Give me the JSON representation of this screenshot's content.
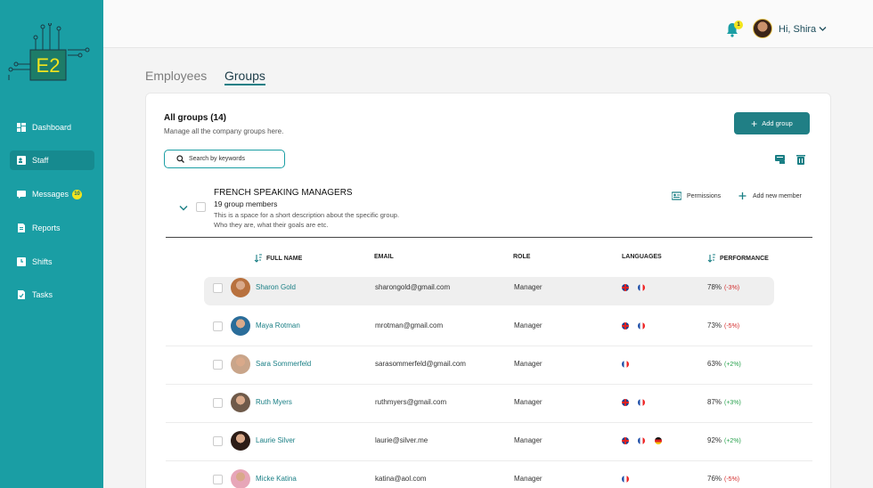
{
  "brand": {
    "logo_text": "E2"
  },
  "sidebar": {
    "items": [
      {
        "label": "Dashboard",
        "icon": "dashboard-icon"
      },
      {
        "label": "Staff",
        "icon": "staff-icon",
        "active": true
      },
      {
        "label": "Messages",
        "icon": "messages-icon",
        "badge": "10"
      },
      {
        "label": "Reports",
        "icon": "reports-icon"
      },
      {
        "label": "Shifts",
        "icon": "shifts-icon"
      },
      {
        "label": "Tasks",
        "icon": "tasks-icon"
      }
    ]
  },
  "header": {
    "notification_count": "1",
    "greeting": "Hi, Shira"
  },
  "tabs": [
    {
      "label": "Employees"
    },
    {
      "label": "Groups",
      "active": true
    }
  ],
  "panel": {
    "title": "All groups (14)",
    "subtitle": "Manage all the company groups here.",
    "add_button": "Add group",
    "search_placeholder": "Search by keywords"
  },
  "group": {
    "name": "FRENCH SPEAKING MANAGERS",
    "members": "19  group members",
    "description_line1": "This is a space for a short description about the specific group.",
    "description_line2": "Who they are, what their goals are etc.",
    "permissions": "Permissions",
    "add_member": "Add new member"
  },
  "table": {
    "columns": {
      "name": "FULL NAME",
      "email": "EMAIL",
      "role": "ROLE",
      "languages": "LANGUAGES",
      "performance": "PERFORMANCE"
    },
    "rows": [
      {
        "name": "Sharon Gold",
        "email": "sharongold@gmail.com",
        "role": "Manager",
        "languages": [
          "uk",
          "fr"
        ],
        "performance": "78%",
        "delta": "(-3%)",
        "trend": "neg",
        "avatar_color": "#b8713e"
      },
      {
        "name": "Maya Rotman",
        "email": "mrotman@gmail.com",
        "role": "Manager",
        "languages": [
          "uk",
          "fr"
        ],
        "performance": "73%",
        "delta": "(-5%)",
        "trend": "neg",
        "avatar_color": "#2a6d9a"
      },
      {
        "name": "Sara Sommerfeld",
        "email": "sarasommerfeld@gmail.com",
        "role": "Manager",
        "languages": [
          "fr"
        ],
        "performance": "63%",
        "delta": "(+2%)",
        "trend": "pos",
        "avatar_color": "#c9a58a"
      },
      {
        "name": "Ruth Myers",
        "email": "ruthmyers@gmail.com",
        "role": "Manager",
        "languages": [
          "uk",
          "fr"
        ],
        "performance": "87%",
        "delta": "(+3%)",
        "trend": "pos",
        "avatar_color": "#6f5a4a"
      },
      {
        "name": "Laurie Silver",
        "email": "laurie@silver.me",
        "role": "Manager",
        "languages": [
          "uk",
          "fr",
          "de"
        ],
        "performance": "92%",
        "delta": "(+2%)",
        "trend": "pos",
        "avatar_color": "#2c1c16"
      },
      {
        "name": "Micke Katina",
        "email": "katina@aol.com",
        "role": "Manager",
        "languages": [
          "fr"
        ],
        "performance": "76%",
        "delta": "(-5%)",
        "trend": "neg",
        "avatar_color": "#e7a6b8"
      }
    ]
  }
}
